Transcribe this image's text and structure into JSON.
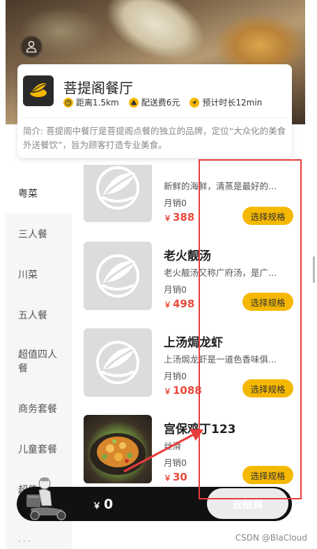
{
  "restaurant": {
    "name": "菩提阁餐厅",
    "distance": "距离1.5km",
    "delivery_fee": "配送费6元",
    "eta": "预计时长12min",
    "description": "简介: 菩提阁中餐厅是菩提阁点餐的独立的品牌，定位“大众化的美食外送餐饮”，旨为顾客打造专业美食。"
  },
  "categories": [
    {
      "label": "粤菜",
      "active": true
    },
    {
      "label": "三人餐",
      "active": false
    },
    {
      "label": "川菜",
      "active": false
    },
    {
      "label": "五人餐",
      "active": false
    },
    {
      "label": "超值四人餐",
      "active": false
    },
    {
      "label": "商务套餐",
      "active": false
    },
    {
      "label": "儿童套餐",
      "active": false
    },
    {
      "label": "超值",
      "active": false
    }
  ],
  "products": [
    {
      "name": "",
      "description": "新鲜的海鲜，清蒸是最好的做法",
      "sales": "月销0",
      "price": "388",
      "currency": "￥",
      "button": "选择规格",
      "image": "placeholder-logo"
    },
    {
      "name": "老火靓汤",
      "description": "老火靓汤又称广府汤，是广府人传承数千年的食补养生秘方",
      "sales": "月销0",
      "price": "498",
      "currency": "￥",
      "button": "选择规格",
      "image": "placeholder-logo"
    },
    {
      "name": "上汤焗龙虾",
      "description": "上汤焗龙虾是一道色香味俱全的传统名菜",
      "sales": "月销0",
      "price": "1088",
      "currency": "￥",
      "button": "选择规格",
      "image": "placeholder-logo"
    },
    {
      "name": "宫保鸡丁123",
      "description": "丝滑",
      "sales": "月销0",
      "price": "30",
      "currency": "￥",
      "button": "选择规格",
      "image": "food-photo"
    }
  ],
  "cart": {
    "currency": "￥",
    "total": "0",
    "checkout_label": "去结算"
  },
  "watermark": "CSDN @BlaCloud",
  "colors": {
    "accent": "#f5b800",
    "price": "#e94b3c",
    "annotation": "#e83b3b"
  }
}
